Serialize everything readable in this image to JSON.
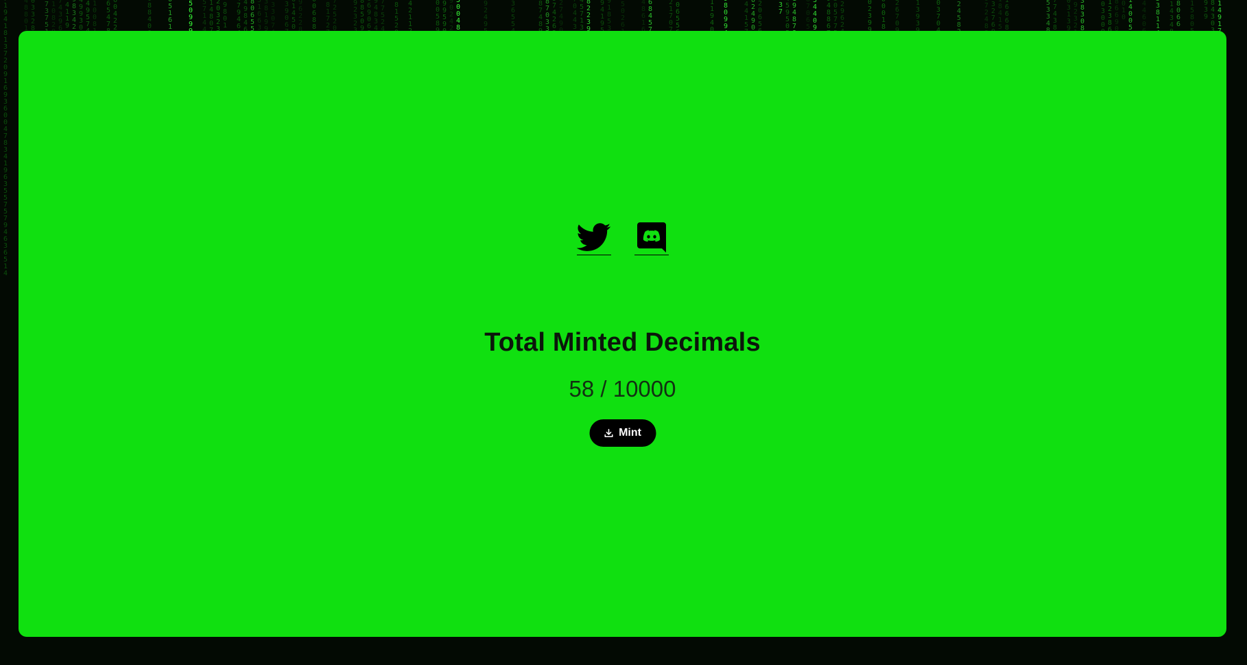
{
  "social": {
    "twitter_icon": "twitter-bird-icon",
    "discord_icon": "discord-icon"
  },
  "stats": {
    "title": "Total Minted Decimals",
    "count": "58 / 10000"
  },
  "mint_button": {
    "label": "Mint",
    "icon": "download-icon"
  },
  "colors": {
    "panel": "#10e010",
    "background": "#030a03",
    "rain_bright": "#3aff3a",
    "rain_dim": "#0f6a0f",
    "button": "#000000",
    "button_text": "#ffffff"
  },
  "rain": {
    "digits": "0123456789"
  }
}
